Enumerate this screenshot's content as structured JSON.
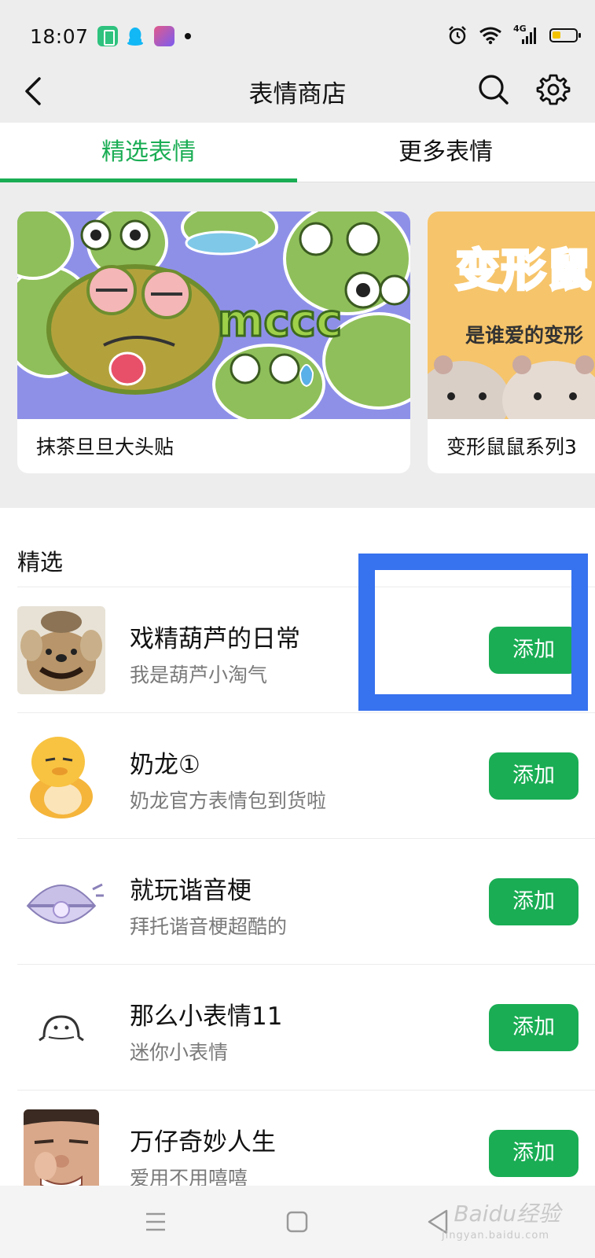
{
  "status_bar": {
    "time": "18:07",
    "signal": "4G",
    "battery_level": 0.3,
    "icons": [
      "battery-saver-app-icon",
      "qq-icon",
      "app-icon",
      "alarm-icon",
      "wifi-icon",
      "signal-icon",
      "battery-icon"
    ]
  },
  "header": {
    "title": "表情商店",
    "back_icon": "chevron-left-icon",
    "search_icon": "search-icon",
    "settings_icon": "gear-icon"
  },
  "tabs": [
    {
      "label": "精选表情",
      "active": true
    },
    {
      "label": "更多表情",
      "active": false
    }
  ],
  "banners": [
    {
      "label": "抹茶旦旦大头贴",
      "image_text": "mccc"
    },
    {
      "label": "变形鼠鼠系列3",
      "image_title": "变形鼠",
      "image_subtitle": "是谁爱的变形"
    }
  ],
  "featured": {
    "header": "精选",
    "items": [
      {
        "title": "戏精葫芦的日常",
        "subtitle": "我是葫芦小淘气",
        "button": "添加"
      },
      {
        "title": "奶龙①",
        "subtitle": "奶龙官方表情包到货啦",
        "button": "添加"
      },
      {
        "title": "就玩谐音梗",
        "subtitle": "拜托谐音梗超酷的",
        "button": "添加"
      },
      {
        "title": "那么小表情11",
        "subtitle": "迷你小表情",
        "button": "添加"
      },
      {
        "title": "万仔奇妙人生",
        "subtitle": "爱用不用嘻嘻",
        "button": "添加"
      }
    ]
  },
  "watermark": {
    "text": "Baidu经验",
    "sub": "jingyan.baidu.com"
  },
  "colors": {
    "accent": "#1aad54",
    "highlight": "#3772ef",
    "background": "#ededed"
  }
}
